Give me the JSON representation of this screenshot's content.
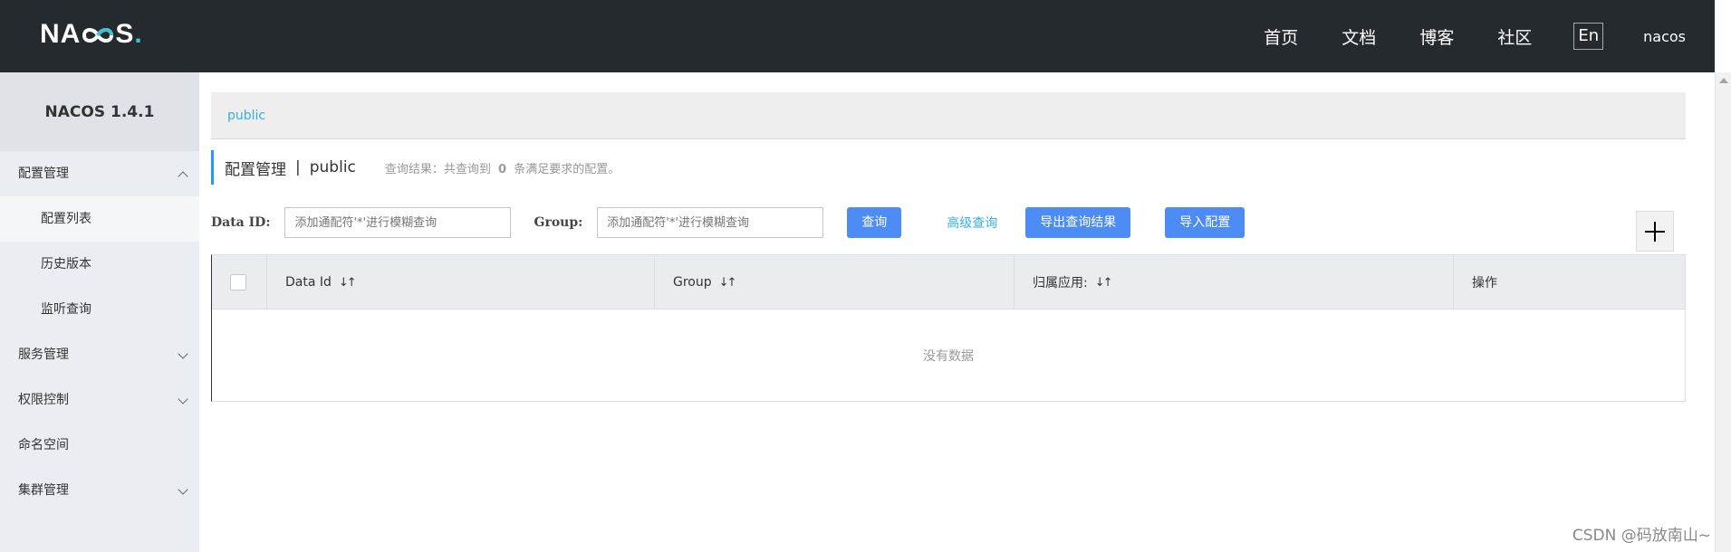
{
  "header": {
    "logo_text_left": "NA",
    "logo_text_right": "S",
    "logo_dot": ".",
    "nav": [
      "首页",
      "文档",
      "博客",
      "社区"
    ],
    "lang": "En",
    "user": "nacos"
  },
  "sidebar": {
    "title": "NACOS 1.4.1",
    "items": [
      {
        "label": "配置管理",
        "type": "group",
        "expanded": true
      },
      {
        "label": "配置列表",
        "type": "sub",
        "active": true
      },
      {
        "label": "历史版本",
        "type": "sub"
      },
      {
        "label": "监听查询",
        "type": "sub"
      },
      {
        "label": "服务管理",
        "type": "group",
        "expanded": false
      },
      {
        "label": "权限控制",
        "type": "group",
        "expanded": false
      },
      {
        "label": "命名空间",
        "type": "item"
      },
      {
        "label": "集群管理",
        "type": "group",
        "expanded": false
      }
    ]
  },
  "main": {
    "namespace_tab": "public",
    "title": "配置管理",
    "separator": "|",
    "namespace": "public",
    "result_prefix": "查询结果：共查询到",
    "result_count": "0",
    "result_suffix": "条满足要求的配置。",
    "filters": {
      "dataid_label": "Data ID:",
      "dataid_placeholder": "添加通配符'*'进行模糊查询",
      "group_label": "Group:",
      "group_placeholder": "添加通配符'*'进行模糊查询",
      "search_btn": "查询",
      "advanced_link": "高级查询",
      "export_btn": "导出查询结果",
      "import_btn": "导入配置"
    },
    "table": {
      "columns": [
        "Data Id",
        "Group",
        "归属应用:",
        "操作"
      ],
      "sort_glyph": "↓↑",
      "empty_text": "没有数据"
    }
  },
  "watermark": "CSDN @码放南山~",
  "colors": {
    "topbar": "#252a2f",
    "sidebar": "#eaedf1",
    "primary_button": "#4d8bf5",
    "link": "#33b1e6"
  }
}
